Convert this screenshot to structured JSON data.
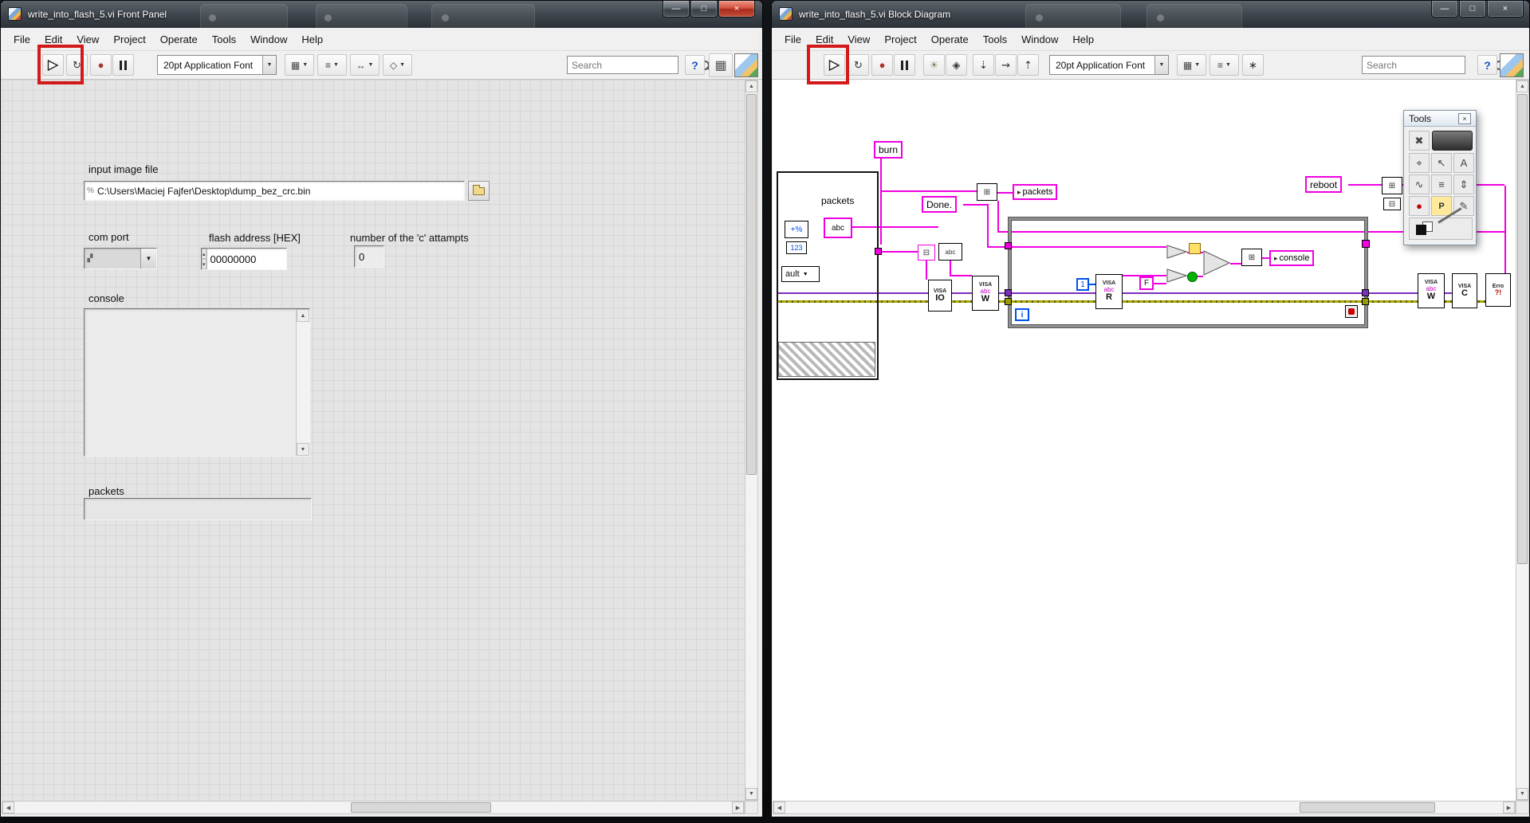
{
  "left_window": {
    "title": "write_into_flash_5.vi Front Panel",
    "menu": [
      "File",
      "Edit",
      "View",
      "Project",
      "Operate",
      "Tools",
      "Window",
      "Help"
    ],
    "toolbar": {
      "font": "20pt Application Font",
      "search_placeholder": "Search",
      "help": "?"
    },
    "panel": {
      "input_image_file": {
        "label": "input image file",
        "value": "C:\\Users\\Maciej Fajfer\\Desktop\\dump_bez_crc.bin"
      },
      "com_port": {
        "label": "com port",
        "value": ""
      },
      "flash_address": {
        "label": "flash address [HEX]",
        "value": "00000000"
      },
      "attempts": {
        "label": "number of the 'c' attampts",
        "value": "0"
      },
      "console": {
        "label": "console",
        "value": ""
      },
      "packets": {
        "label": "packets",
        "value": ""
      }
    }
  },
  "right_window": {
    "title": "write_into_flash_5.vi Block Diagram",
    "menu": [
      "File",
      "Edit",
      "View",
      "Project",
      "Operate",
      "Tools",
      "Window",
      "Help"
    ],
    "toolbar": {
      "font": "20pt Application Font",
      "search_placeholder": "Search",
      "help": "?"
    },
    "diagram": {
      "burn": "burn",
      "packets_free_label": "packets",
      "string_constant": "abc",
      "done": "Done.",
      "packets_indicator": "packets",
      "console_indicator": "console",
      "reboot": "reboot",
      "case_selector": "ault",
      "numeric_123": "123",
      "plus_node": "+%",
      "one_constant": "1",
      "false_constant": "F",
      "iteration_terminal": "i",
      "io_node": "IO",
      "abc_small": "abc",
      "visa": {
        "title": "VISA",
        "abc": "abc",
        "w": "W",
        "r": "R",
        "c": "C"
      },
      "error_node": {
        "line1": "Erro",
        "line2": "?!"
      }
    },
    "tools_palette": {
      "title": "Tools"
    }
  },
  "icons": {
    "minimize": "—",
    "maximize": "□",
    "close": "×",
    "run_continuous": "↻",
    "abort": "●",
    "lightbulb": "☀",
    "retain_values": "◈",
    "step_into": "⇣",
    "step_over": "⇝",
    "step_out": "⇡",
    "dropdown": "▼",
    "align": "▦",
    "distribute": "≡",
    "resize": "↔",
    "reorder": "◇",
    "cleanup": "∗",
    "grid": "▦",
    "up": "▲",
    "down": "▼",
    "left": "◀",
    "right": "▶",
    "spin_up": "▴",
    "spin_down": "▾",
    "concat": "⊞",
    "fmt": "⊟",
    "arrow_in": "▸",
    "io": "▞",
    "path": "%",
    "tools": {
      "auto": "✖",
      "operate": "⌖",
      "select": "↖",
      "text": "A",
      "wire": "∿",
      "shortcut": "≡",
      "scroll": "⇕",
      "breakpoint": "●",
      "probe": "P",
      "copy_color": "✎"
    }
  }
}
